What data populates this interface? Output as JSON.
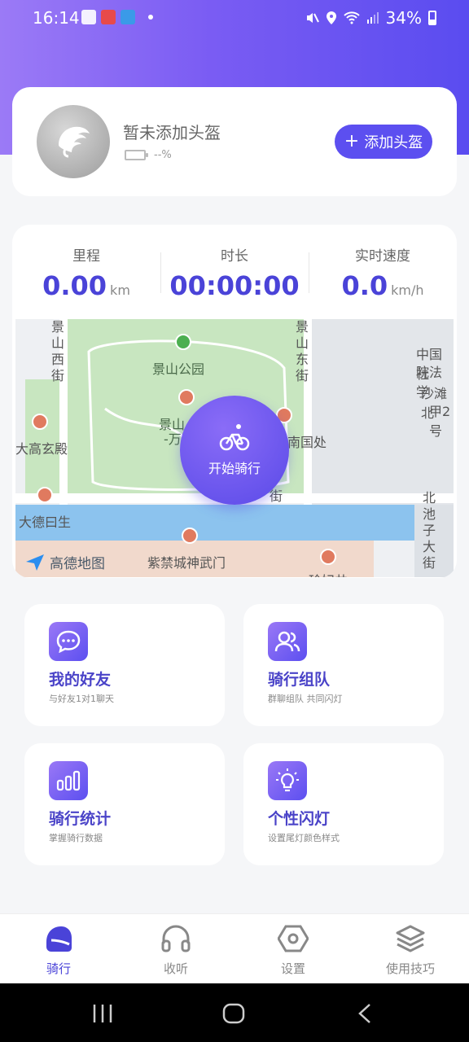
{
  "status_bar": {
    "time": "16:14",
    "battery": "34%"
  },
  "helmet": {
    "title": "暂未添加头盔",
    "battery_text": "--%",
    "add_button": "添加头盔"
  },
  "stats": [
    {
      "label": "里程",
      "value": "0.00",
      "unit": "km"
    },
    {
      "label": "时长",
      "value": "00:00:00",
      "unit": ""
    },
    {
      "label": "实时速度",
      "value": "0.0",
      "unit": "km/h"
    }
  ],
  "map": {
    "labels": [
      "景山公园",
      "景山西街",
      "景山东街",
      "大高玄殿",
      "大德曰生",
      "紫禁城神武门",
      "中国社",
      "院法学",
      "沙滩北",
      "甲2号",
      "北池子大街",
      "南国处",
      "景山",
      "-万",
      "街",
      "珍妃井"
    ],
    "logo": "高德地图"
  },
  "start_button": "开始骑行",
  "features": [
    {
      "title": "我的好友",
      "subtitle": "与好友1对1聊天",
      "icon": "chat-icon"
    },
    {
      "title": "骑行组队",
      "subtitle": "群聊组队 共同闪灯",
      "icon": "group-icon"
    },
    {
      "title": "骑行统计",
      "subtitle": "掌握骑行数据",
      "icon": "bar-chart-icon"
    },
    {
      "title": "个性闪灯",
      "subtitle": "设置尾灯颜色样式",
      "icon": "bulb-icon"
    }
  ],
  "bottom_nav": [
    {
      "label": "骑行",
      "active": true
    },
    {
      "label": "收听",
      "active": false
    },
    {
      "label": "设置",
      "active": false
    },
    {
      "label": "使用技巧",
      "active": false
    }
  ],
  "colors": {
    "accent": "#5c4ff0",
    "accent_dark": "#4a43d8"
  }
}
